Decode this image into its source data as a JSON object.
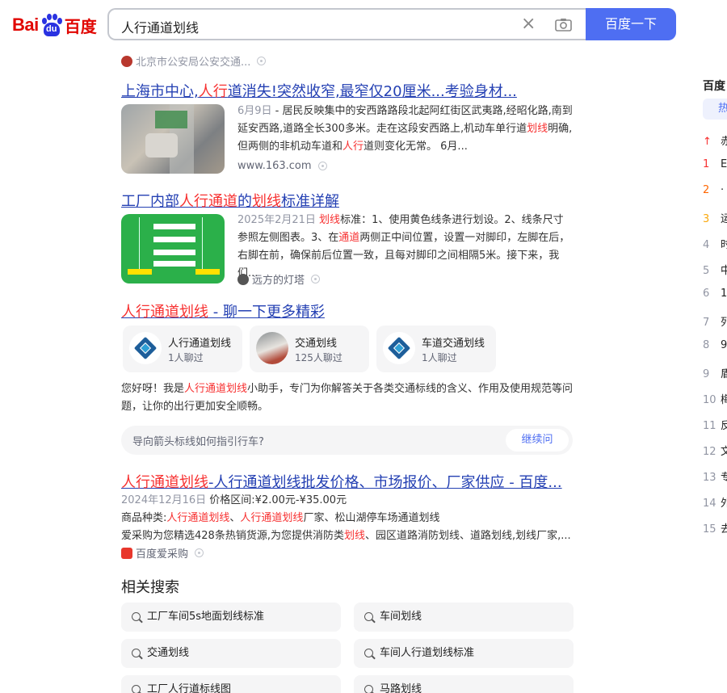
{
  "header": {
    "logo_text_left": "Bai",
    "logo_paw_text": "du",
    "logo_text_right": "百度",
    "query": "人行通道划线",
    "clear_icon": "close-icon",
    "camera_icon": "camera-icon",
    "search_button": "百度一下"
  },
  "top_source": {
    "text": "北京市公安局公安交通..."
  },
  "results": [
    {
      "title_a": "上海市中心,",
      "title_hl1": "人行",
      "title_b": "道消失!突然收窄,最窄仅20厘米...考验身材...",
      "date": "6月9日",
      "snippet_a": " - 居民反映集中的安西路路段北起阿红街区武夷路,经昭化路,南到延安西路,道路全长300多米。走在这段安西路上,机动车单行道",
      "snippet_hl1": "划线",
      "snippet_b": "明确,但两侧的非机动车道和",
      "snippet_hl2": "人行",
      "snippet_c": "道则变化无常。 6月...",
      "source": "www.163.com"
    },
    {
      "title_a": "工厂内部",
      "title_hl1": "人行通道",
      "title_b": "的",
      "title_hl2": "划线",
      "title_c": "标准详解",
      "date": "2025年2月21日",
      "snippet_hl0": "划线",
      "snippet_a": "标准：1、使用黄色线条进行划设。2、线条尺寸参照左侧图表。3、在",
      "snippet_hl1": "通道",
      "snippet_b": "两侧正中间位置，设置一对脚印，左脚在后，右脚在前，确保前后位置一致，且每对脚印之间相隔5米。接下来，我们...",
      "source": "远方的灯塔"
    }
  ],
  "ai": {
    "title_hl": "人行通道划线",
    "title_rest": " - 聊一下更多精彩",
    "cards": [
      {
        "name": "人行通道划线",
        "count": "1人聊过"
      },
      {
        "name": "交通划线",
        "count": "125人聊过"
      },
      {
        "name": "车道交通划线",
        "count": "1人聊过"
      }
    ],
    "intro_a": "您好呀！我是",
    "intro_hl": "人行通道划线",
    "intro_b": "小助手，专门为你解答关于各类交通标线的含义、作用及使用规范等问题，让你的出行更加安全顺畅。",
    "chat_placeholder": "导向箭头标线如何指引行车?",
    "continue_label": "继续问"
  },
  "result3": {
    "title_hl": "人行通道划线",
    "title_rest": "-人行通道划线批发价格、市场报价、厂家供应 - 百度...",
    "date": "2024年12月16日",
    "price": " 价格区间:¥2.00元-¥35.00元",
    "line2_a": "商品种类:",
    "line2_hl1": "人行通道划线",
    "line2_b": "、",
    "line2_hl2": "人行通道划线",
    "line2_c": "厂家、松山湖停车场通道划线",
    "line3_a": "爱采购为您精选428条热销货源,为您提供消防类",
    "line3_hl": "划线",
    "line3_b": "、园区道路消防划线、道路划线,划线厂家,...",
    "source": "百度爱采购"
  },
  "related": {
    "heading": "相关搜索",
    "items": [
      "工厂车间5s地面划线标准",
      "车间划线",
      "交通划线",
      "车间人行道划线标准",
      "工厂人行道标线图",
      "马路划线"
    ]
  },
  "sidebar": {
    "heading": "百度",
    "tab": "热",
    "rows": [
      {
        "n": "↑",
        "t": "赤",
        "color": "#f73131"
      },
      {
        "n": "1",
        "t": "E",
        "color": "#f73131"
      },
      {
        "n": "2",
        "t": "·",
        "color": "#ff6600"
      },
      {
        "n": "3",
        "t": "运",
        "color": "#faa90e"
      },
      {
        "n": "4",
        "t": "时",
        "color": "#9195a3"
      },
      {
        "n": "5",
        "t": "中",
        "color": "#9195a3"
      },
      {
        "n": "6",
        "t": "1",
        "color": "#9195a3"
      },
      {
        "n": "7",
        "t": "列",
        "color": "#9195a3"
      },
      {
        "n": "8",
        "t": "9",
        "color": "#9195a3"
      },
      {
        "n": "9",
        "t": "盾",
        "color": "#9195a3"
      },
      {
        "n": "10",
        "t": "梅",
        "color": "#9195a3"
      },
      {
        "n": "11",
        "t": "反",
        "color": "#9195a3"
      },
      {
        "n": "12",
        "t": "文",
        "color": "#9195a3"
      },
      {
        "n": "13",
        "t": "专",
        "color": "#9195a3"
      },
      {
        "n": "14",
        "t": "外",
        "color": "#9195a3"
      },
      {
        "n": "15",
        "t": "去",
        "color": "#9195a3"
      }
    ]
  },
  "colors": {
    "brand_blue": "#4e6ef2",
    "highlight_red": "#f73131",
    "link_blue": "#2440b3"
  }
}
